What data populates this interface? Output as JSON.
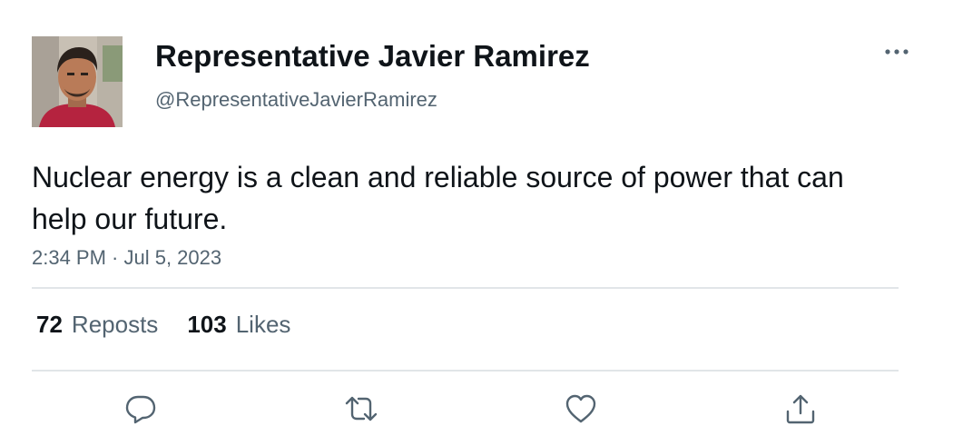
{
  "author": {
    "display_name": "Representative Javier Ramirez",
    "handle": "@RepresentativeJavierRamirez",
    "avatar": "profile-photo"
  },
  "tweet": {
    "text": "Nuclear energy is a clean and reliable source of power that can help our future.",
    "timestamp": "2:34 PM · Jul 5, 2023"
  },
  "stats": {
    "reposts_count": "72",
    "reposts_label": "Reposts",
    "likes_count": "103",
    "likes_label": "Likes"
  },
  "actions": {
    "reply_icon": "reply-icon",
    "repost_icon": "repost-icon",
    "like_icon": "heart-icon",
    "share_icon": "share-icon"
  },
  "colors": {
    "text_primary": "#0f1419",
    "text_secondary": "#536471",
    "divider": "#e1e5e8",
    "icon": "#536471"
  }
}
